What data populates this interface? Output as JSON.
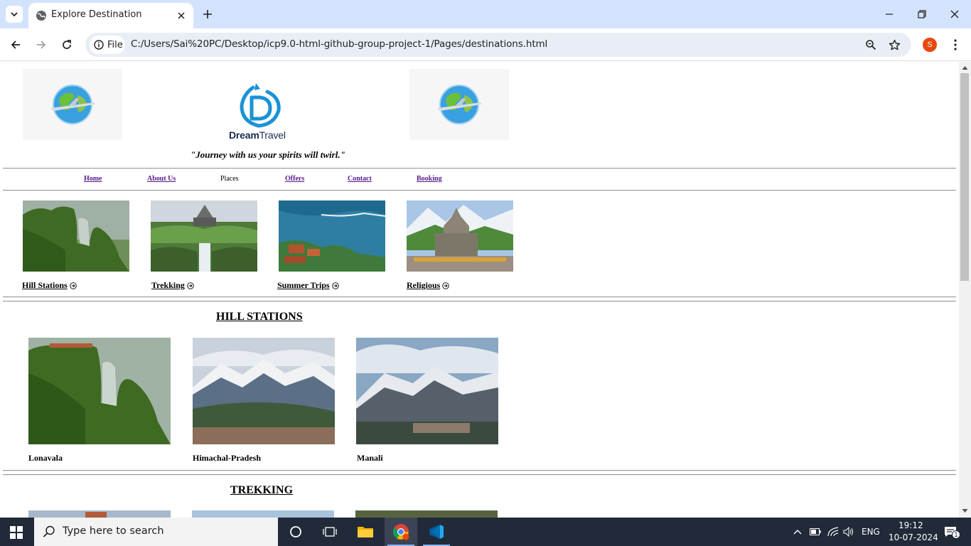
{
  "browser": {
    "tab_title": "Explore Destination",
    "chip_label": "File",
    "url": "C:/Users/Sai%20PC/Desktop/icp9.0-html-github-group-project-1/Pages/destinations.html",
    "profile_initial": "S"
  },
  "site": {
    "brand_bold": "Dream",
    "brand_regular": "Travel",
    "tagline": "\"Journey with us your spirits will twirl.\""
  },
  "nav": {
    "home": "Home",
    "about": "About Us",
    "places": "Places",
    "offers": "Offers",
    "contact": "Contact",
    "booking": "Booking"
  },
  "categories": [
    {
      "label": "Hill Stations"
    },
    {
      "label": "Trekking"
    },
    {
      "label": "Summer Trips"
    },
    {
      "label": "Religious"
    }
  ],
  "sections": {
    "hill_stations": {
      "title": "HILL STATIONS",
      "places": [
        {
          "name": "Lonavala"
        },
        {
          "name": "Himachal-Pradesh"
        },
        {
          "name": "Manali"
        }
      ]
    },
    "trekking": {
      "title": "TREKKING"
    }
  },
  "taskbar": {
    "search_placeholder": "Type here to search",
    "language": "ENG",
    "time": "19:12",
    "date": "10-07-2024",
    "notification_count": "1"
  }
}
